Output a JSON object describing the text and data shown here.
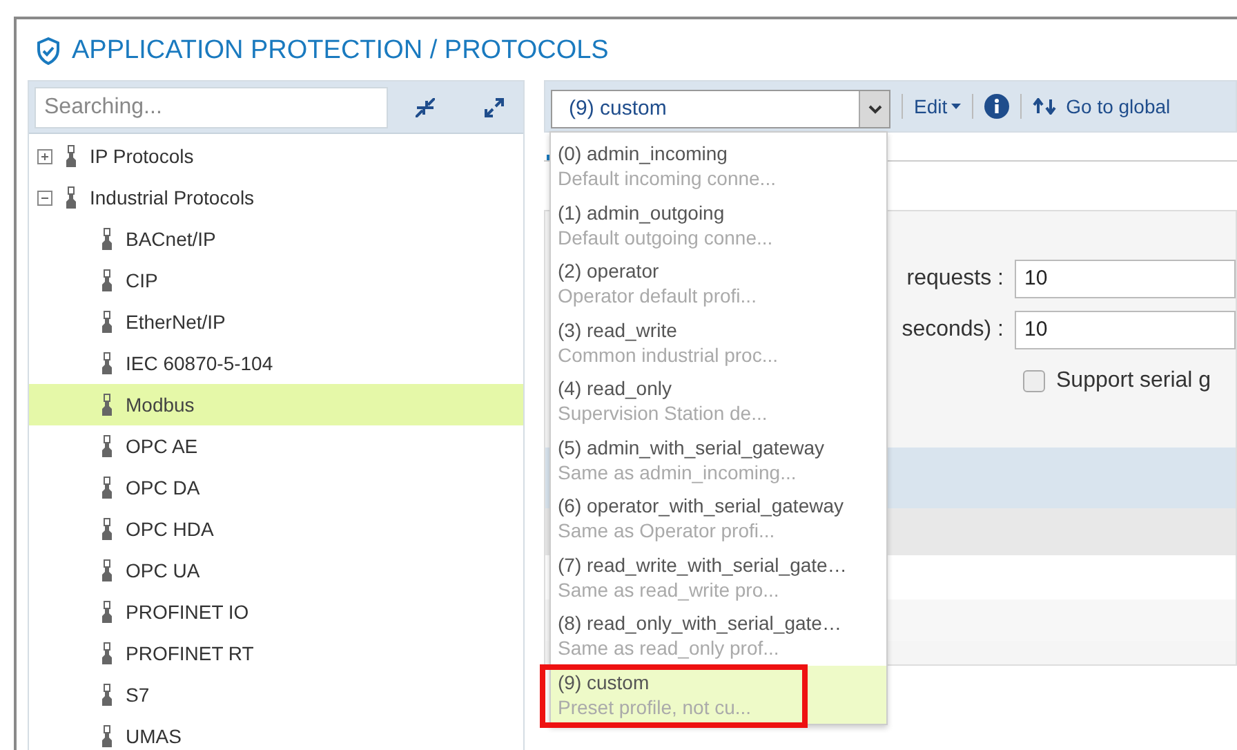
{
  "title": "APPLICATION PROTECTION / PROTOCOLS",
  "search": {
    "placeholder": "Searching..."
  },
  "tree": [
    {
      "label": "IP Protocols",
      "expanded": false,
      "selected": false
    },
    {
      "label": "Industrial Protocols",
      "expanded": true,
      "selected": false,
      "children": [
        {
          "label": "BACnet/IP",
          "selected": false
        },
        {
          "label": "CIP",
          "selected": false
        },
        {
          "label": "EtherNet/IP",
          "selected": false
        },
        {
          "label": "IEC 60870-5-104",
          "selected": false
        },
        {
          "label": "Modbus",
          "selected": true
        },
        {
          "label": "OPC AE",
          "selected": false
        },
        {
          "label": "OPC DA",
          "selected": false
        },
        {
          "label": "OPC HDA",
          "selected": false
        },
        {
          "label": "OPC UA",
          "selected": false
        },
        {
          "label": "PROFINET IO",
          "selected": false
        },
        {
          "label": "PROFINET RT",
          "selected": false
        },
        {
          "label": "S7",
          "selected": false
        },
        {
          "label": "UMAS",
          "selected": false
        }
      ]
    }
  ],
  "profile_select": {
    "value": "(9) custom",
    "expanded": true
  },
  "toolbar": {
    "edit": "Edit",
    "goto": "Go to global"
  },
  "profiles": [
    {
      "name": "(0) admin_incoming",
      "description": "Default incoming conne...",
      "selected": false
    },
    {
      "name": "(1) admin_outgoing",
      "description": "Default outgoing conne...",
      "selected": false
    },
    {
      "name": "(2) operator",
      "description": "Operator default profi...",
      "selected": false
    },
    {
      "name": "(3) read_write",
      "description": "Common industrial proc...",
      "selected": false
    },
    {
      "name": "(4) read_only",
      "description": "Supervision Station de...",
      "selected": false
    },
    {
      "name": "(5) admin_with_serial_gateway",
      "description": "Same as admin_incoming...",
      "selected": false
    },
    {
      "name": "(6) operator_with_serial_gateway",
      "description": "Same as Operator profi...",
      "selected": false
    },
    {
      "name": "(7) read_write_with_serial_gate…",
      "description": "Same as read_write pro...",
      "selected": false
    },
    {
      "name": "(8) read_only_with_serial_gate…",
      "description": "Same as read_only prof...",
      "selected": false
    },
    {
      "name": "(9) custom",
      "description": "Preset profile, not cu...",
      "selected": true
    }
  ],
  "fields": [
    {
      "label": "requests :",
      "value": "10"
    },
    {
      "label": "seconds) :",
      "value": "10"
    }
  ],
  "serial_gateway": {
    "label": "Support serial g",
    "checked": false
  }
}
